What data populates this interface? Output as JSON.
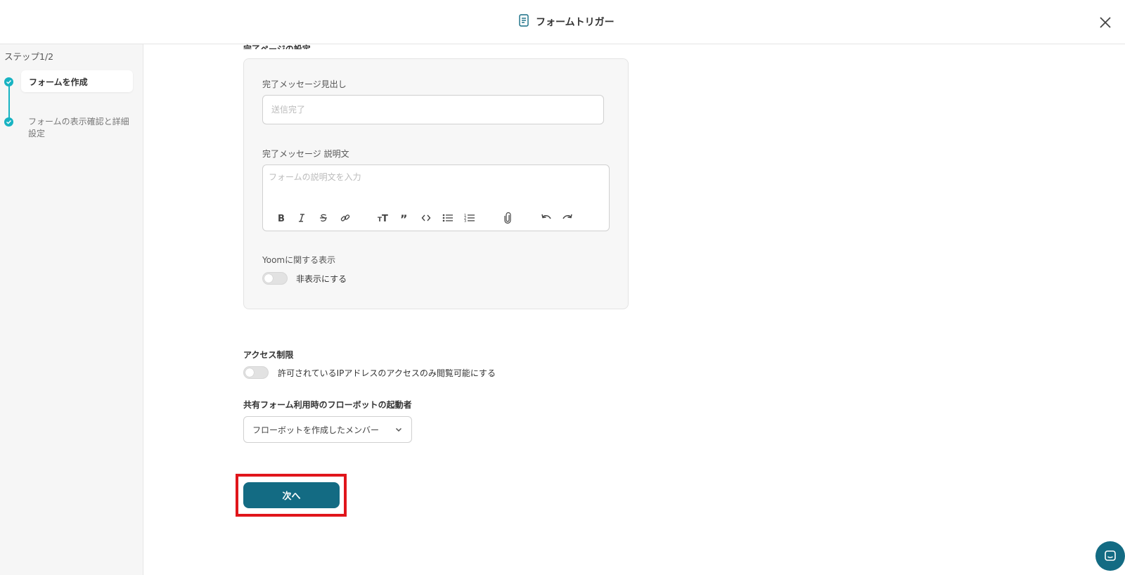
{
  "header": {
    "title": "フォームトリガー",
    "icon": "form-scroll-icon"
  },
  "sidebar": {
    "step_label": "ステップ1/2",
    "steps": [
      {
        "label": "フォームを作成"
      },
      {
        "label": "フォームの表示確認と詳細設定"
      }
    ]
  },
  "main": {
    "partial_heading": "完了ページの設定",
    "completion": {
      "title_label": "完了メッセージ見出し",
      "title_placeholder": "送信完了",
      "desc_label": "完了メッセージ 説明文",
      "desc_placeholder": "フォームの説明文を入力",
      "yoom_label": "Yoomに関する表示",
      "yoom_toggle_label": "非表示にする"
    },
    "access": {
      "heading": "アクセス制限",
      "toggle_label": "許可されているIPアドレスのアクセスのみ閲覧可能にする"
    },
    "shared": {
      "heading": "共有フォーム利用時のフローボットの起動者",
      "selected": "フローボットを作成したメンバー"
    },
    "next_label": "次へ"
  },
  "colors": {
    "accent": "#136b83",
    "step": "#17b3c2",
    "highlight": "#e0151b"
  }
}
